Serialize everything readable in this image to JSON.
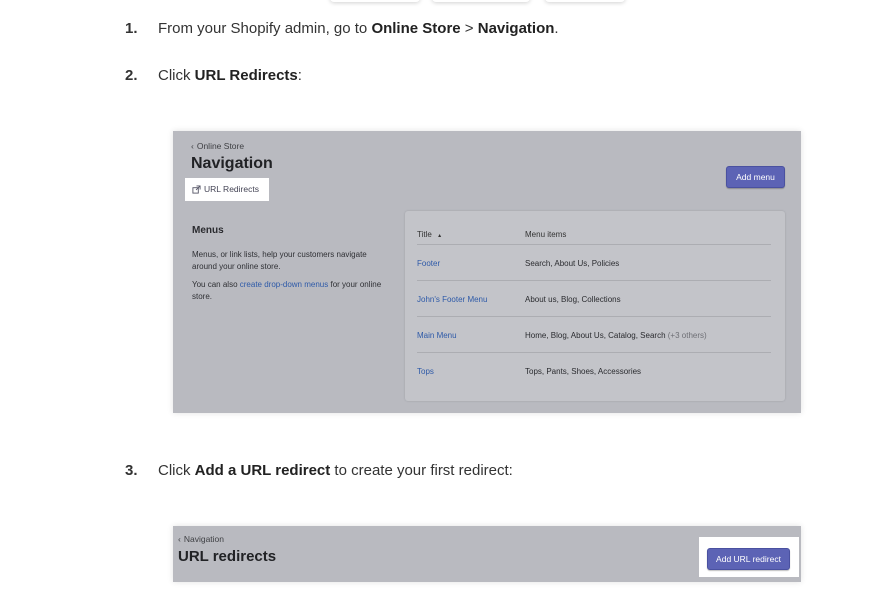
{
  "steps": [
    {
      "num": "1.",
      "parts": [
        "From your Shopify admin, go to ",
        "Online Store",
        " > ",
        "Navigation",
        "."
      ]
    },
    {
      "num": "2.",
      "parts": [
        "Click ",
        "URL Redirects",
        ":"
      ]
    },
    {
      "num": "3.",
      "parts": [
        "Click ",
        "Add a URL redirect",
        " to create your first redirect:"
      ]
    }
  ],
  "screenshot1": {
    "breadcrumb": "Online Store",
    "title": "Navigation",
    "add_menu_label": "Add menu",
    "url_redirects_label": "URL Redirects",
    "menus_title": "Menus",
    "menus_desc": "Menus, or link lists, help your customers navigate around your online store.",
    "menus_desc2_before": "You can also ",
    "menus_desc2_link": "create drop-down menus",
    "menus_desc2_after": " for your online store.",
    "table": {
      "col_title": "Title",
      "sort_indicator": "▴",
      "col_items": "Menu items",
      "rows": [
        {
          "title": "Footer",
          "items": "Search, About Us, Policies",
          "extra": ""
        },
        {
          "title": "John's Footer Menu",
          "items": "About us, Blog, Collections",
          "extra": ""
        },
        {
          "title": "Main Menu",
          "items": "Home, Blog, About Us, Catalog, Search",
          "extra": "(+3 others)"
        },
        {
          "title": "Tops",
          "items": "Tops, Pants, Shoes, Accessories",
          "extra": ""
        }
      ]
    }
  },
  "screenshot2": {
    "breadcrumb": "Navigation",
    "title": "URL redirects",
    "add_button_label": "Add URL redirect"
  },
  "icons": {
    "chevron": "chevron-left-icon",
    "external": "external-link-icon"
  },
  "colors": {
    "primary_button": "#5c63b5",
    "link": "#2e5aa8",
    "overlay": "#b9bac0"
  }
}
